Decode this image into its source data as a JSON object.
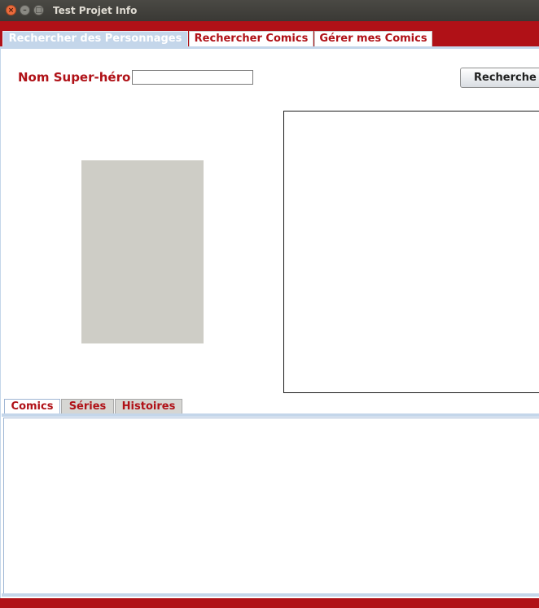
{
  "window": {
    "title": "Test Projet Info",
    "buttons": {
      "close": "×",
      "minimize": "–",
      "maximize": "□"
    }
  },
  "tabs": [
    {
      "label": "Rechercher des Personnages",
      "active": true
    },
    {
      "label": "Rechercher Comics",
      "active": false
    },
    {
      "label": "Gérer mes Comics",
      "active": false
    }
  ],
  "search": {
    "label": "Nom Super-héro",
    "value": "",
    "button_label": "Recherche"
  },
  "sub_tabs": [
    {
      "label": "Comics",
      "active": true
    },
    {
      "label": "Séries",
      "active": false
    },
    {
      "label": "Histoires",
      "active": false
    }
  ],
  "colors": {
    "accent": "#b01117",
    "tab_active": "#c4d6ea",
    "image_placeholder": "#cecdc6"
  }
}
